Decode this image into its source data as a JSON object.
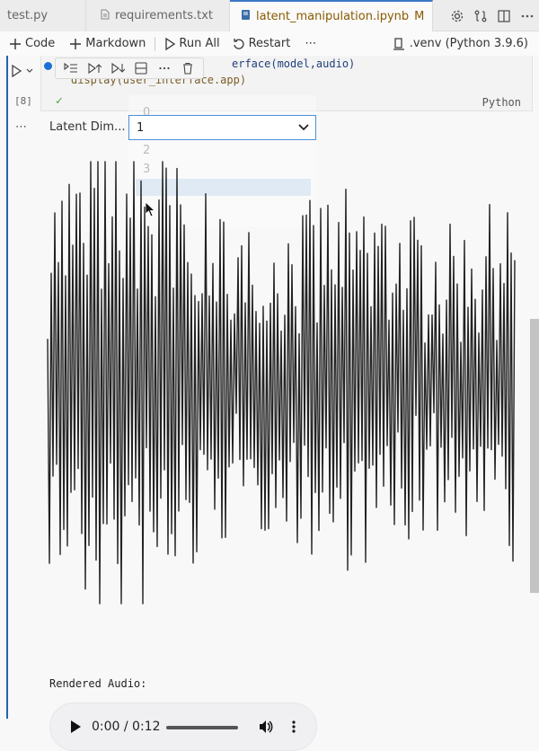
{
  "tabs": [
    {
      "label": "test.py",
      "icon": "python-file-icon"
    },
    {
      "label": "requirements.txt",
      "icon": "text-file-icon"
    },
    {
      "label": "latent_manipulation.ipynb",
      "icon": "notebook-icon",
      "badge": "M",
      "active": true
    }
  ],
  "tab_actions": [
    "settings-icon",
    "git-compare-icon",
    "split-editor-icon",
    "more-icon"
  ],
  "toolbar": {
    "code_label": "Code",
    "markdown_label": "Markdown",
    "run_all_label": "Run All",
    "restart_label": "Restart",
    "more_label": "⋯",
    "kernel_label": ".venv (Python 3.9.6)"
  },
  "cell": {
    "code_line1": "erface(model,audio)",
    "code_line2": "display(user_interface.app)",
    "exec_count": "[8]",
    "language": "Python",
    "status": "✓"
  },
  "output": {
    "more_label": "⋯",
    "latent_label": "Latent Dim...",
    "selected_value": "1",
    "options": [
      "0",
      "1",
      "2",
      "3"
    ],
    "rendered_label": "Rendered Audio:",
    "audio_time": "0:00 / 0:12"
  },
  "colors": {
    "accent": "#2563b0",
    "waveform": "#222222",
    "select_border": "#4a90d9"
  }
}
